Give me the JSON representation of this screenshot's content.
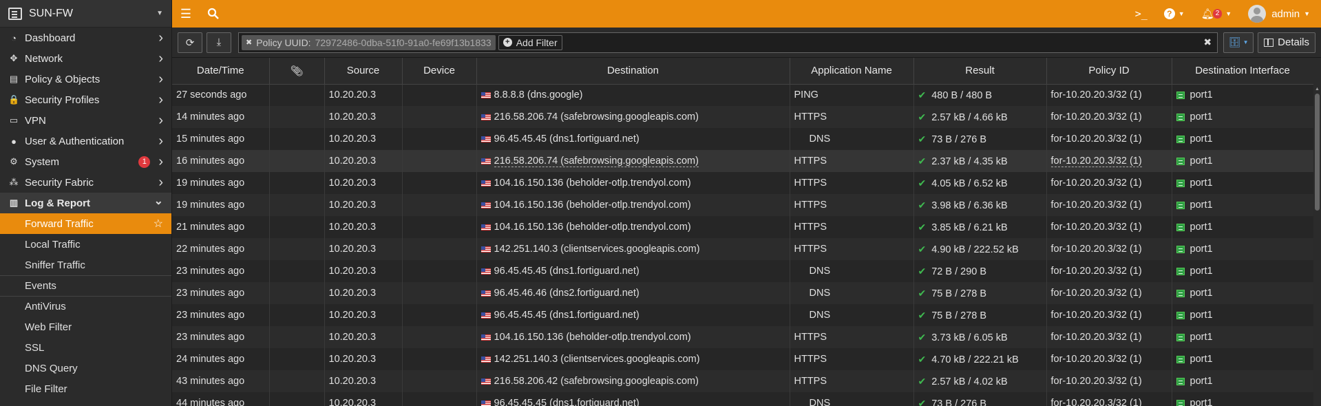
{
  "brand": {
    "name": "SUN-FW"
  },
  "sidebar": {
    "items": [
      {
        "label": "Dashboard",
        "icon": "dashboard-icon",
        "glyph": "◔"
      },
      {
        "label": "Network",
        "icon": "network-icon",
        "glyph": "✥"
      },
      {
        "label": "Policy & Objects",
        "icon": "policy-icon",
        "glyph": "▤"
      },
      {
        "label": "Security Profiles",
        "icon": "lock-icon",
        "glyph": "🔒"
      },
      {
        "label": "VPN",
        "icon": "monitor-icon",
        "glyph": "▭"
      },
      {
        "label": "User & Authentication",
        "icon": "user-icon",
        "glyph": "●"
      },
      {
        "label": "System",
        "icon": "gear-icon",
        "glyph": "⚙",
        "badge": "1"
      },
      {
        "label": "Security Fabric",
        "icon": "fabric-icon",
        "glyph": "⁂"
      },
      {
        "label": "Log & Report",
        "icon": "chart-icon",
        "glyph": "▥"
      }
    ],
    "log_sub": [
      "Forward Traffic",
      "Local Traffic",
      "Sniffer Traffic"
    ],
    "events_sub": [
      "Events"
    ],
    "security_sub": [
      "AntiVirus",
      "Web Filter",
      "SSL",
      "DNS Query",
      "File Filter"
    ]
  },
  "topbar": {
    "user": "admin",
    "notifications": "2"
  },
  "filter": {
    "chip_label": "Policy UUID:",
    "chip_value": "72972486-0dba-51f0-91a0-fe69f13b1833",
    "add_filter": "Add Filter",
    "details": "Details"
  },
  "columns": [
    "Date/Time",
    "",
    "Source",
    "Device",
    "Destination",
    "Application Name",
    "Result",
    "Policy ID",
    "Destination Interface"
  ],
  "rows": [
    {
      "time": "27 seconds ago",
      "src": "10.20.20.3",
      "dst": "8.8.8.8 (dns.google)",
      "app": "PING",
      "result": "480 B / 480 B",
      "policy": "for-10.20.20.3/32 (1)",
      "iface": "port1"
    },
    {
      "time": "14 minutes ago",
      "src": "10.20.20.3",
      "dst": "216.58.206.74 (safebrowsing.googleapis.com)",
      "app": "HTTPS",
      "result": "2.57 kB / 4.66 kB",
      "policy": "for-10.20.20.3/32 (1)",
      "iface": "port1"
    },
    {
      "time": "15 minutes ago",
      "src": "10.20.20.3",
      "dst": "96.45.45.45 (dns1.fortiguard.net)",
      "app": "DNS",
      "result": "73 B / 276 B",
      "policy": "for-10.20.20.3/32 (1)",
      "iface": "port1"
    },
    {
      "time": "16 minutes ago",
      "src": "10.20.20.3",
      "dst": "216.58.206.74 (safebrowsing.googleapis.com)",
      "app": "HTTPS",
      "result": "2.37 kB / 4.35 kB",
      "policy": "for-10.20.20.3/32 (1)",
      "iface": "port1"
    },
    {
      "time": "19 minutes ago",
      "src": "10.20.20.3",
      "dst": "104.16.150.136 (beholder-otlp.trendyol.com)",
      "app": "HTTPS",
      "result": "4.05 kB / 6.52 kB",
      "policy": "for-10.20.20.3/32 (1)",
      "iface": "port1"
    },
    {
      "time": "19 minutes ago",
      "src": "10.20.20.3",
      "dst": "104.16.150.136 (beholder-otlp.trendyol.com)",
      "app": "HTTPS",
      "result": "3.98 kB / 6.36 kB",
      "policy": "for-10.20.20.3/32 (1)",
      "iface": "port1"
    },
    {
      "time": "21 minutes ago",
      "src": "10.20.20.3",
      "dst": "104.16.150.136 (beholder-otlp.trendyol.com)",
      "app": "HTTPS",
      "result": "3.85 kB / 6.21 kB",
      "policy": "for-10.20.20.3/32 (1)",
      "iface": "port1"
    },
    {
      "time": "22 minutes ago",
      "src": "10.20.20.3",
      "dst": "142.251.140.3 (clientservices.googleapis.com)",
      "app": "HTTPS",
      "result": "4.90 kB / 222.52 kB",
      "policy": "for-10.20.20.3/32 (1)",
      "iface": "port1"
    },
    {
      "time": "23 minutes ago",
      "src": "10.20.20.3",
      "dst": "96.45.45.45 (dns1.fortiguard.net)",
      "app": "DNS",
      "result": "72 B / 290 B",
      "policy": "for-10.20.20.3/32 (1)",
      "iface": "port1"
    },
    {
      "time": "23 minutes ago",
      "src": "10.20.20.3",
      "dst": "96.45.46.46 (dns2.fortiguard.net)",
      "app": "DNS",
      "result": "75 B / 278 B",
      "policy": "for-10.20.20.3/32 (1)",
      "iface": "port1"
    },
    {
      "time": "23 minutes ago",
      "src": "10.20.20.3",
      "dst": "96.45.45.45 (dns1.fortiguard.net)",
      "app": "DNS",
      "result": "75 B / 278 B",
      "policy": "for-10.20.20.3/32 (1)",
      "iface": "port1"
    },
    {
      "time": "23 minutes ago",
      "src": "10.20.20.3",
      "dst": "104.16.150.136 (beholder-otlp.trendyol.com)",
      "app": "HTTPS",
      "result": "3.73 kB / 6.05 kB",
      "policy": "for-10.20.20.3/32 (1)",
      "iface": "port1"
    },
    {
      "time": "24 minutes ago",
      "src": "10.20.20.3",
      "dst": "142.251.140.3 (clientservices.googleapis.com)",
      "app": "HTTPS",
      "result": "4.70 kB / 222.21 kB",
      "policy": "for-10.20.20.3/32 (1)",
      "iface": "port1"
    },
    {
      "time": "43 minutes ago",
      "src": "10.20.20.3",
      "dst": "216.58.206.42 (safebrowsing.googleapis.com)",
      "app": "HTTPS",
      "result": "2.57 kB / 4.02 kB",
      "policy": "for-10.20.20.3/32 (1)",
      "iface": "port1"
    },
    {
      "time": "44 minutes ago",
      "src": "10.20.20.3",
      "dst": "96.45.45.45 (dns1.fortiguard.net)",
      "app": "DNS",
      "result": "73 B / 276 B",
      "policy": "for-10.20.20.3/32 (1)",
      "iface": "port1"
    }
  ],
  "colors": {
    "accent": "#e98b0d",
    "success": "#3fb950",
    "badge": "#e0393e"
  }
}
